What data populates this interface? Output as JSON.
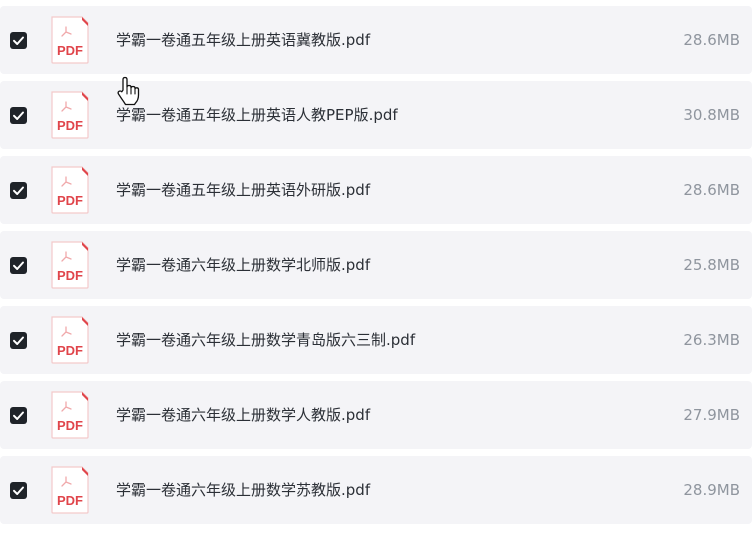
{
  "colors": {
    "row_background": "#f4f4f7",
    "checkbox": "#1f2329",
    "pdf_red": "#e0454b",
    "name_text": "#2b2f36",
    "size_text": "#8f959e"
  },
  "icons": {
    "checkbox": "checkbox-checked-icon",
    "file": "pdf-file-icon",
    "cursor": "hand-pointer-cursor-icon"
  },
  "pdf_label": "PDF",
  "files": [
    {
      "name": "学霸一卷通五年级上册英语冀教版.pdf",
      "size": "28.6MB",
      "checked": true
    },
    {
      "name": "学霸一卷通五年级上册英语人教PEP版.pdf",
      "size": "30.8MB",
      "checked": true
    },
    {
      "name": "学霸一卷通五年级上册英语外研版.pdf",
      "size": "28.6MB",
      "checked": true
    },
    {
      "name": "学霸一卷通六年级上册数学北师版.pdf",
      "size": "25.8MB",
      "checked": true
    },
    {
      "name": "学霸一卷通六年级上册数学青岛版六三制.pdf",
      "size": "26.3MB",
      "checked": true
    },
    {
      "name": "学霸一卷通六年级上册数学人教版.pdf",
      "size": "27.9MB",
      "checked": true
    },
    {
      "name": "学霸一卷通六年级上册数学苏教版.pdf",
      "size": "28.9MB",
      "checked": true
    }
  ]
}
